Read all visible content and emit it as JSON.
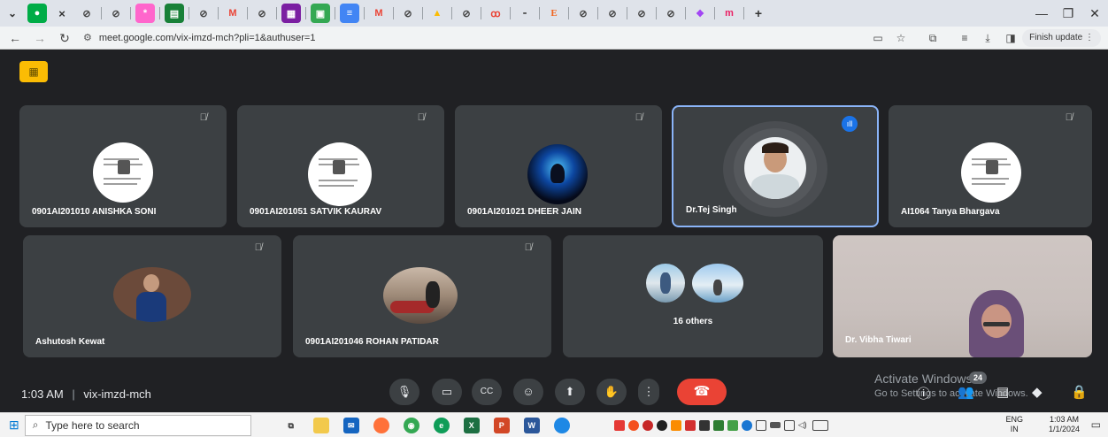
{
  "browser": {
    "url": "meet.google.com/vix-imzd-mch?pli=1&authuser=1",
    "finish_update": "Finish update",
    "tab_close": "×",
    "new_tab": "+",
    "minimize": "—",
    "restore": "❐",
    "close": "✕"
  },
  "participants": [
    {
      "name": "0901AI201010 ANISHKA SONI",
      "muted": true
    },
    {
      "name": "0901AI201051 SATVIK KAURAV",
      "muted": true
    },
    {
      "name": "0901AI201021 DHEER JAIN",
      "muted": true
    },
    {
      "name": "Dr.Tej Singh",
      "muted": false,
      "speaking": true
    },
    {
      "name": "AI1064 Tanya Bhargava",
      "muted": true
    },
    {
      "name": "Ashutosh Kewat",
      "muted": true
    },
    {
      "name": "0901AI201046 ROHAN PATIDAR",
      "muted": true
    },
    {
      "name": "16 others"
    },
    {
      "name": "Dr. Vibha Tiwari"
    }
  ],
  "meeting": {
    "time": "1:03 AM",
    "separator": "|",
    "code": "vix-imzd-mch",
    "people_count": "24"
  },
  "watermark": {
    "title": "Activate Windows",
    "subtitle": "Go to Settings to activate Windows."
  },
  "taskbar": {
    "search_placeholder": "Type here to search",
    "lang_1": "ENG",
    "lang_2": "IN",
    "time": "1:03 AM",
    "date": "1/1/2024"
  },
  "colors": {
    "accent": "#1a73e8",
    "leave": "#ea4335",
    "tile": "#3c4043",
    "background": "#202124"
  }
}
